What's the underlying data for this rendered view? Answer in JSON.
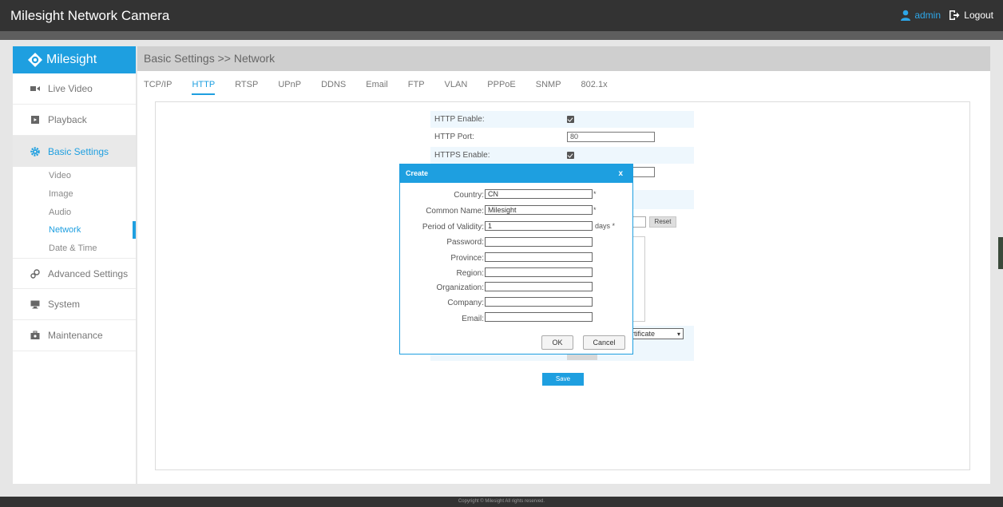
{
  "app": {
    "title": "Milesight Network Camera",
    "user": "admin",
    "logout_label": "Logout"
  },
  "logo": {
    "text": "Milesight"
  },
  "sidebar": {
    "items": [
      {
        "label": "Live Video",
        "icon": "video-camera-icon"
      },
      {
        "label": "Playback",
        "icon": "playback-icon"
      },
      {
        "label": "Basic Settings",
        "icon": "gear-icon"
      },
      {
        "label": "Advanced Settings",
        "icon": "gears-icon"
      },
      {
        "label": "System",
        "icon": "monitor-icon"
      },
      {
        "label": "Maintenance",
        "icon": "toolbox-icon"
      }
    ],
    "sub_items": [
      "Video",
      "Image",
      "Audio",
      "Network",
      "Date & Time"
    ]
  },
  "main": {
    "breadcrumb": "Basic Settings >> Network",
    "tabs": [
      "TCP/IP",
      "HTTP",
      "RTSP",
      "UPnP",
      "DDNS",
      "Email",
      "FTP",
      "VLAN",
      "PPPoE",
      "SNMP",
      "802.1x"
    ],
    "active_tab": "HTTP"
  },
  "form": {
    "http_enable_label": "HTTP Enable:",
    "http_enable_checked": true,
    "http_port_label": "HTTP Port:",
    "http_port_value": "80",
    "https_enable_label": "HTTPS Enable:",
    "https_enable_checked": true,
    "reset_label": "Reset",
    "cert_select_value": "rtificate",
    "save_label": "Save"
  },
  "modal": {
    "title": "Create",
    "close": "x",
    "fields": [
      {
        "label": "Country:",
        "value": "CN",
        "note": "*"
      },
      {
        "label": "Common Name:",
        "value": "Milesight",
        "note": "*"
      },
      {
        "label": "Period of Validity:",
        "value": "1",
        "note": "days *"
      },
      {
        "label": "Password:",
        "value": "",
        "note": ""
      },
      {
        "label": "Province:",
        "value": "",
        "note": ""
      },
      {
        "label": "Region:",
        "value": "",
        "note": ""
      },
      {
        "label": "Organization:",
        "value": "",
        "note": ""
      },
      {
        "label": "Company:",
        "value": "",
        "note": ""
      },
      {
        "label": "Email:",
        "value": "",
        "note": ""
      }
    ],
    "ok_label": "OK",
    "cancel_label": "Cancel"
  },
  "footer": {
    "copyright": "Copyright © Milesight All rights reserved."
  },
  "colors": {
    "accent": "#1e9fe0",
    "topbar": "#333333"
  }
}
